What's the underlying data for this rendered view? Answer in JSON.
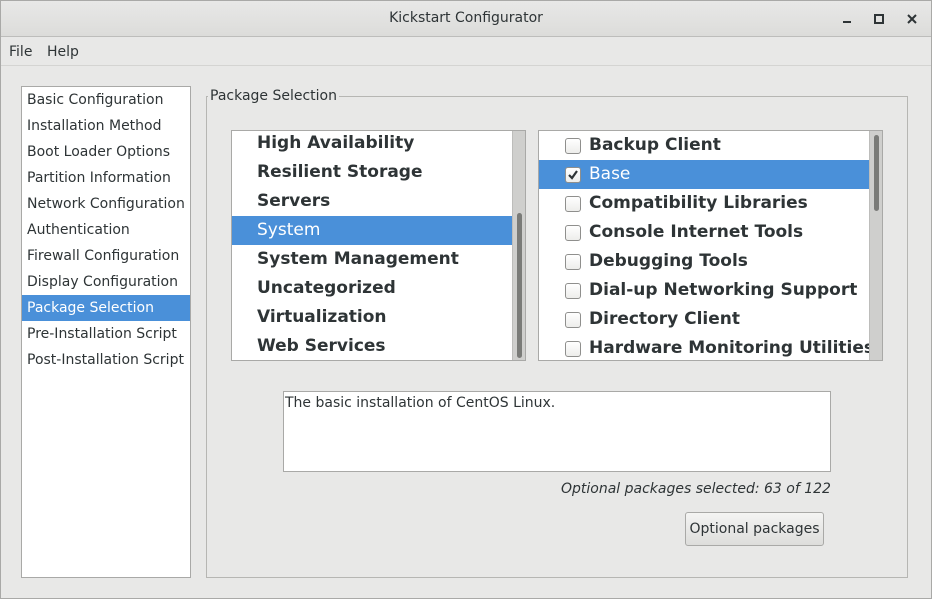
{
  "window": {
    "title": "Kickstart Configurator"
  },
  "menubar": {
    "items": [
      {
        "label": "File"
      },
      {
        "label": "Help"
      }
    ]
  },
  "nav": {
    "items": [
      {
        "label": "Basic Configuration"
      },
      {
        "label": "Installation Method"
      },
      {
        "label": "Boot Loader Options"
      },
      {
        "label": "Partition Information"
      },
      {
        "label": "Network Configuration"
      },
      {
        "label": "Authentication"
      },
      {
        "label": "Firewall Configuration"
      },
      {
        "label": "Display Configuration"
      },
      {
        "label": "Package Selection",
        "selected": true
      },
      {
        "label": "Pre-Installation Script"
      },
      {
        "label": "Post-Installation Script"
      }
    ]
  },
  "package_selection": {
    "frame_label": "Package Selection",
    "groups": [
      {
        "label": "High Availability"
      },
      {
        "label": "Resilient Storage"
      },
      {
        "label": "Servers"
      },
      {
        "label": "System",
        "selected": true
      },
      {
        "label": "System Management"
      },
      {
        "label": "Uncategorized"
      },
      {
        "label": "Virtualization"
      },
      {
        "label": "Web Services"
      }
    ],
    "packages": [
      {
        "label": "Backup Client",
        "checked": false
      },
      {
        "label": "Base",
        "checked": true,
        "selected": true
      },
      {
        "label": "Compatibility Libraries",
        "checked": false
      },
      {
        "label": "Console Internet Tools",
        "checked": false
      },
      {
        "label": "Debugging Tools",
        "checked": false
      },
      {
        "label": "Dial-up Networking Support",
        "checked": false
      },
      {
        "label": "Directory Client",
        "checked": false
      },
      {
        "label": "Hardware Monitoring Utilities",
        "checked": false
      }
    ],
    "description": "The basic installation of CentOS Linux.",
    "optional_status": "Optional packages selected: 63 of 122",
    "optional_button_label": "Optional packages"
  },
  "colors": {
    "selection": "#4a90d9",
    "window_bg": "#e8e8e7"
  }
}
